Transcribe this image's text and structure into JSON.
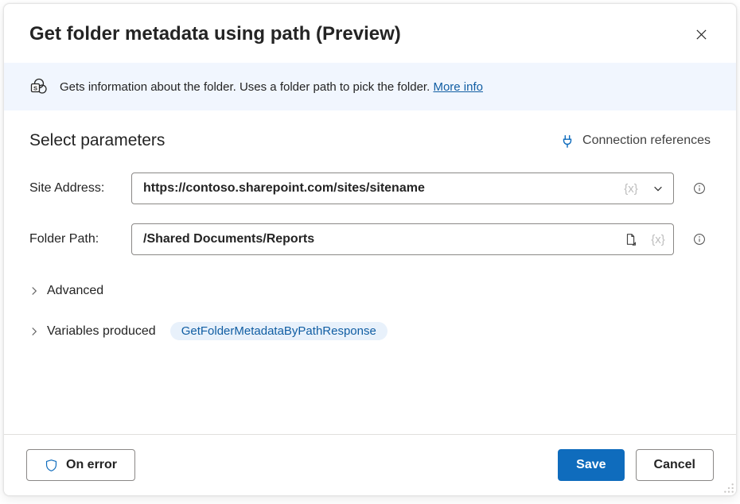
{
  "header": {
    "title": "Get folder metadata using path (Preview)"
  },
  "banner": {
    "text": "Gets information about the folder. Uses a folder path to pick the folder. ",
    "more_info": "More info"
  },
  "section": {
    "title": "Select parameters",
    "connection_refs": "Connection references"
  },
  "fields": {
    "site_address": {
      "label": "Site Address:",
      "value": "https://contoso.sharepoint.com/sites/sitename"
    },
    "folder_path": {
      "label": "Folder Path:",
      "value": "/Shared Documents/Reports"
    }
  },
  "expanders": {
    "advanced": "Advanced",
    "variables_produced": "Variables produced",
    "variable_chip": "GetFolderMetadataByPathResponse"
  },
  "footer": {
    "on_error": "On error",
    "save": "Save",
    "cancel": "Cancel"
  }
}
